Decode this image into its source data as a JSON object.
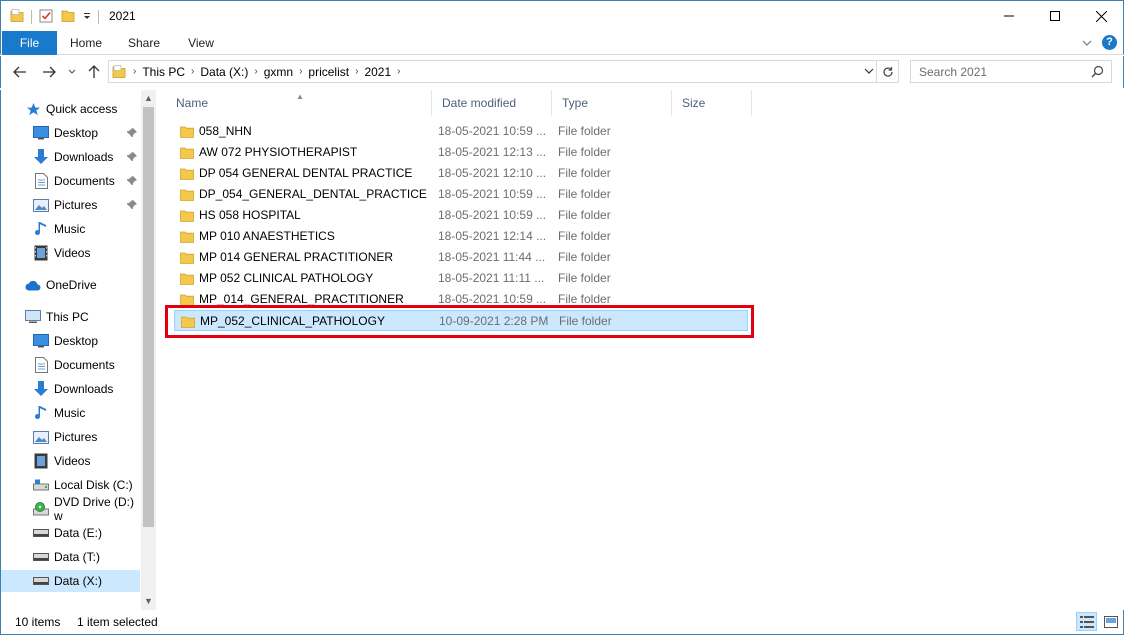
{
  "window": {
    "title": "2021"
  },
  "ribbon": {
    "tabs": [
      "File",
      "Home",
      "Share",
      "View"
    ]
  },
  "address": {
    "crumbs": [
      "This PC",
      "Data (X:)",
      "gxmn",
      "pricelist",
      "2021"
    ]
  },
  "search": {
    "placeholder": "Search 2021"
  },
  "sidebar": {
    "items": [
      {
        "label": "Quick access",
        "icon": "star-icon"
      },
      {
        "label": "Desktop",
        "icon": "desktop-icon"
      },
      {
        "label": "Downloads",
        "icon": "download-icon"
      },
      {
        "label": "Documents",
        "icon": "documents-icon"
      },
      {
        "label": "Pictures",
        "icon": "pictures-icon"
      },
      {
        "label": "Music",
        "icon": "music-icon"
      },
      {
        "label": "Videos",
        "icon": "videos-icon"
      },
      {
        "label": "OneDrive",
        "icon": "cloud-icon"
      },
      {
        "label": "This PC",
        "icon": "computer-icon"
      },
      {
        "label": "Desktop",
        "icon": "desktop-icon"
      },
      {
        "label": "Documents",
        "icon": "documents-icon"
      },
      {
        "label": "Downloads",
        "icon": "download-icon"
      },
      {
        "label": "Music",
        "icon": "music-icon"
      },
      {
        "label": "Pictures",
        "icon": "pictures-icon"
      },
      {
        "label": "Videos",
        "icon": "videos-icon"
      },
      {
        "label": "Local Disk (C:)",
        "icon": "drive-icon"
      },
      {
        "label": "DVD Drive (D:) w",
        "icon": "dvd-icon"
      },
      {
        "label": "Data (E:)",
        "icon": "drive-icon"
      },
      {
        "label": "Data (T:)",
        "icon": "drive-icon"
      },
      {
        "label": "Data (X:)",
        "icon": "drive-icon"
      }
    ]
  },
  "columns": {
    "name": "Name",
    "date": "Date modified",
    "type": "Type",
    "size": "Size"
  },
  "files": [
    {
      "name": "058_NHN",
      "date": "18-05-2021 10:59 ...",
      "type": "File folder"
    },
    {
      "name": "AW 072 PHYSIOTHERAPIST",
      "date": "18-05-2021 12:13 ...",
      "type": "File folder"
    },
    {
      "name": "DP 054 GENERAL DENTAL PRACTICE",
      "date": "18-05-2021 12:10 ...",
      "type": "File folder"
    },
    {
      "name": "DP_054_GENERAL_DENTAL_PRACTICE",
      "date": "18-05-2021 10:59 ...",
      "type": "File folder"
    },
    {
      "name": "HS 058 HOSPITAL",
      "date": "18-05-2021 10:59 ...",
      "type": "File folder"
    },
    {
      "name": "MP 010 ANAESTHETICS",
      "date": "18-05-2021 12:14 ...",
      "type": "File folder"
    },
    {
      "name": "MP 014 GENERAL PRACTITIONER",
      "date": "18-05-2021 11:44 ...",
      "type": "File folder"
    },
    {
      "name": "MP 052 CLINICAL PATHOLOGY",
      "date": "18-05-2021 11:11 ...",
      "type": "File folder"
    },
    {
      "name": "MP_014_GENERAL_PRACTITIONER",
      "date": "18-05-2021 10:59 ...",
      "type": "File folder"
    },
    {
      "name": "MP_052_CLINICAL_PATHOLOGY",
      "date": "10-09-2021 2:28 PM",
      "type": "File folder"
    }
  ],
  "status": {
    "count": "10 items",
    "selected": "1 item selected"
  },
  "colors": {
    "accent": "#1979ca",
    "selection": "#cce8ff",
    "highlight_box": "#e0000f",
    "folder": "#f2c94c"
  }
}
